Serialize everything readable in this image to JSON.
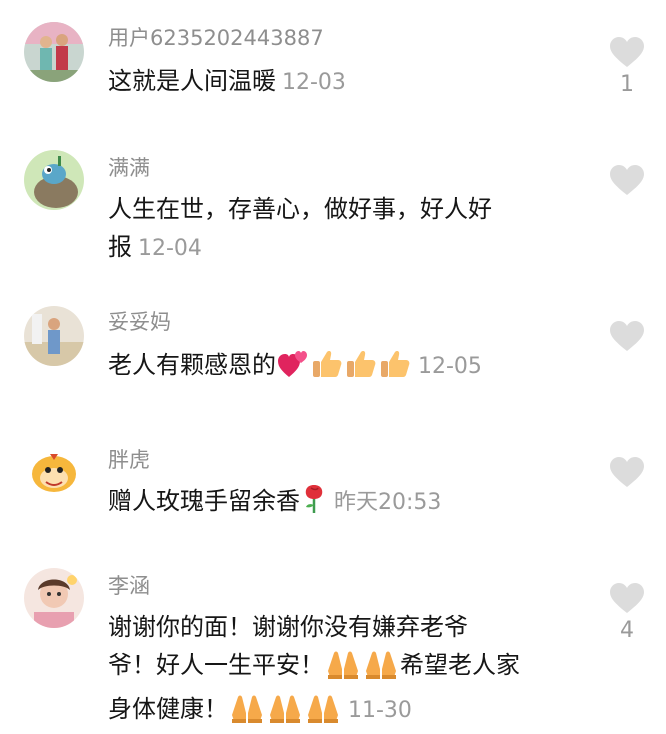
{
  "comments": [
    {
      "username": "用户6235202443887",
      "text": "这就是人间温暖",
      "time": "12-03",
      "likes": "1"
    },
    {
      "username": "满满",
      "text_line1": "人生在世，存善心，做好事，好人好",
      "text_line2": "报",
      "time": "12-04",
      "likes": ""
    },
    {
      "username": "妥妥妈",
      "text": "老人有颗感恩的",
      "emojis": [
        "two-hearts",
        "thumbs-up",
        "thumbs-up",
        "thumbs-up"
      ],
      "time": "12-05",
      "likes": ""
    },
    {
      "username": "胖虎",
      "text": "赠人玫瑰手留余香",
      "emojis": [
        "rose"
      ],
      "time": "昨天20:53",
      "likes": ""
    },
    {
      "username": "李涵",
      "text_line1": "谢谢你的面！谢谢你没有嫌弃老爷",
      "text_line2_a": "爷！好人一生平安！",
      "text_line2_b": "希望老人家",
      "text_line3": "身体健康！",
      "emojis_line2": [
        "folded-hands",
        "folded-hands"
      ],
      "emojis_line3": [
        "folded-hands",
        "folded-hands",
        "folded-hands"
      ],
      "time": "11-30",
      "likes": "4"
    }
  ]
}
